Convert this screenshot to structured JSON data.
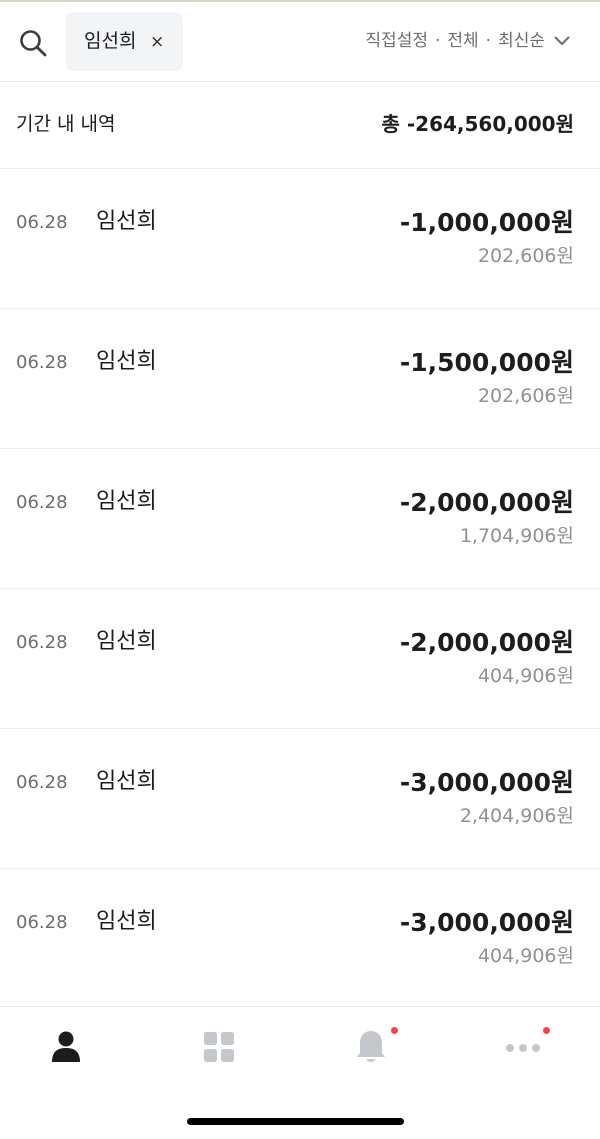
{
  "header": {
    "search_icon": "search-icon",
    "chip_label": "임선희",
    "chip_close": "×",
    "filter": {
      "period": "직접설정",
      "separator": "·",
      "type": "전체",
      "order": "최신순",
      "chevron_icon": "chevron-down-icon"
    }
  },
  "summary": {
    "label": "기간 내 내역",
    "total": "총 -264,560,000원"
  },
  "transactions": [
    {
      "date": "06.28",
      "name": "임선희",
      "amount": "-1,000,000원",
      "balance": "202,606원"
    },
    {
      "date": "06.28",
      "name": "임선희",
      "amount": "-1,500,000원",
      "balance": "202,606원"
    },
    {
      "date": "06.28",
      "name": "임선희",
      "amount": "-2,000,000원",
      "balance": "1,704,906원"
    },
    {
      "date": "06.28",
      "name": "임선희",
      "amount": "-2,000,000원",
      "balance": "404,906원"
    },
    {
      "date": "06.28",
      "name": "임선희",
      "amount": "-3,000,000원",
      "balance": "2,404,906원"
    },
    {
      "date": "06.28",
      "name": "임선희",
      "amount": "-3,000,000원",
      "balance": "404,906원"
    }
  ],
  "nav": {
    "items": [
      {
        "icon": "person-icon",
        "active": true
      },
      {
        "icon": "grid-icon",
        "active": false
      },
      {
        "icon": "bell-icon",
        "active": false,
        "badge": true
      },
      {
        "icon": "more-icon",
        "active": false,
        "badge": true
      }
    ],
    "active_color": "#1b1d1f",
    "inactive_color": "#c4c7cc",
    "badge_color": "#f04452"
  }
}
